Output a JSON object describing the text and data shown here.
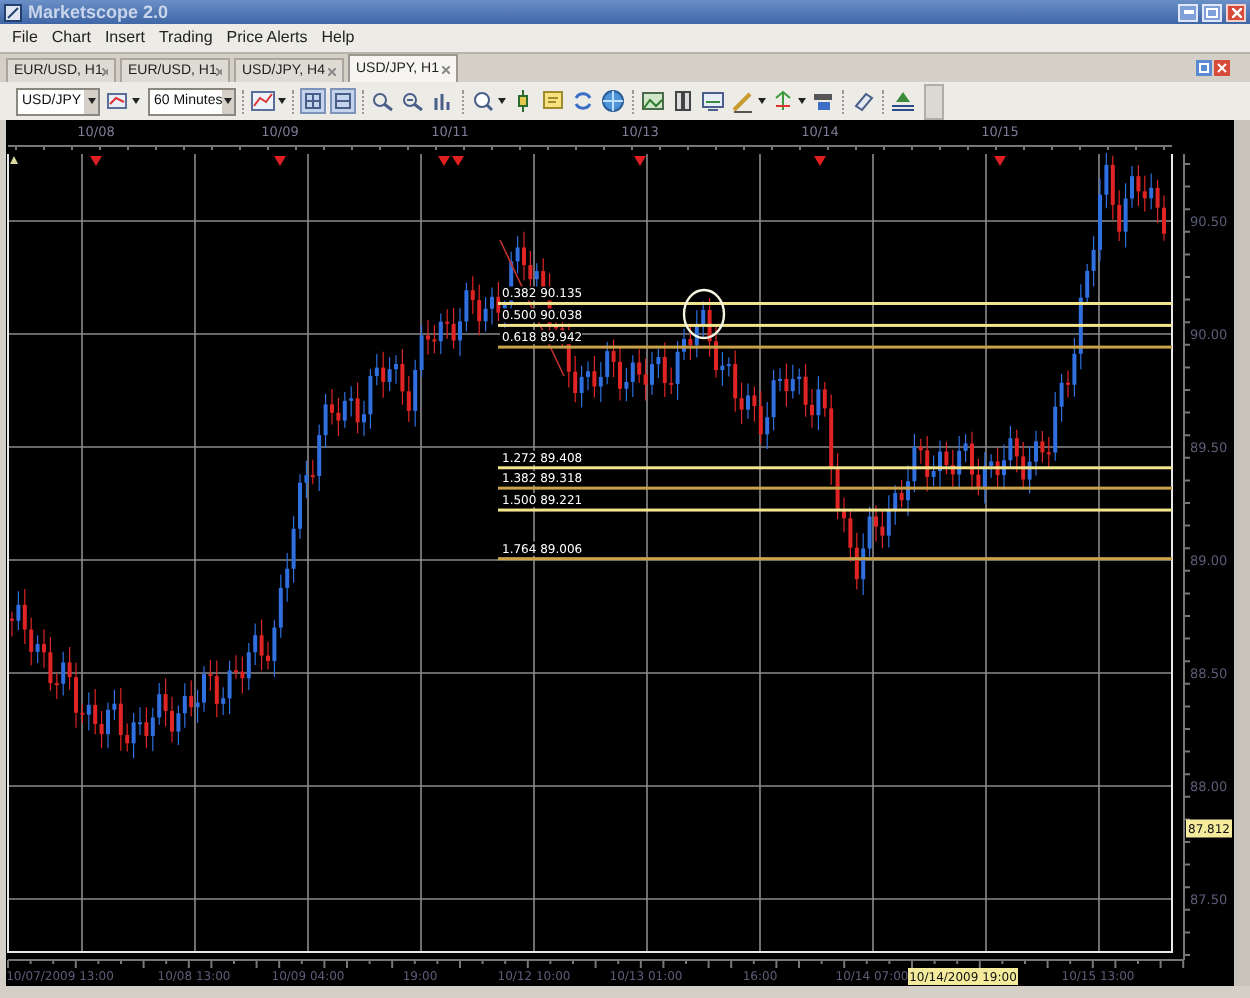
{
  "window": {
    "title": "Marketscope 2.0"
  },
  "menu": [
    "File",
    "Chart",
    "Insert",
    "Trading",
    "Price Alerts",
    "Help"
  ],
  "tabs": [
    {
      "label": "EUR/USD, H1",
      "selected": false
    },
    {
      "label": "EUR/USD, H1",
      "selected": false
    },
    {
      "label": "USD/JPY, H4",
      "selected": false
    },
    {
      "label": "USD/JPY, H1",
      "selected": true
    }
  ],
  "toolbar": {
    "symbol": "USD/JPY",
    "timeframe": "60 Minutes"
  },
  "chart": {
    "top_axis_labels": [
      "10/08",
      "10/09",
      "10/11",
      "10/13",
      "10/14",
      "10/15"
    ],
    "price_axis_labels": [
      "90.50",
      "90.00",
      "89.50",
      "89.00",
      "88.50",
      "88.00",
      "87.50"
    ],
    "time_axis_labels": [
      "10/07/2009 13:00",
      "10/08 13:00",
      "10/09 04:00",
      "19:00",
      "10/12 10:00",
      "10/13 01:00",
      "16:00",
      "10/14 07:00",
      "10/15 13:00"
    ],
    "current_price": "87.812",
    "cursor_time": "10/14/2009 19:00",
    "fib_levels": [
      {
        "ratio": "0.382",
        "price": "90.135",
        "color": "#f2e48a"
      },
      {
        "ratio": "0.500",
        "price": "90.038",
        "color": "#f2e48a"
      },
      {
        "ratio": "0.618",
        "price": "89.942",
        "color": "#c9a24a"
      },
      {
        "ratio": "1.272",
        "price": "89.408",
        "color": "#f2e48a"
      },
      {
        "ratio": "1.382",
        "price": "89.318",
        "color": "#c9a24a"
      },
      {
        "ratio": "1.500",
        "price": "89.221",
        "color": "#f2e48a"
      },
      {
        "ratio": "1.764",
        "price": "89.006",
        "color": "#c9a24a"
      }
    ]
  }
}
